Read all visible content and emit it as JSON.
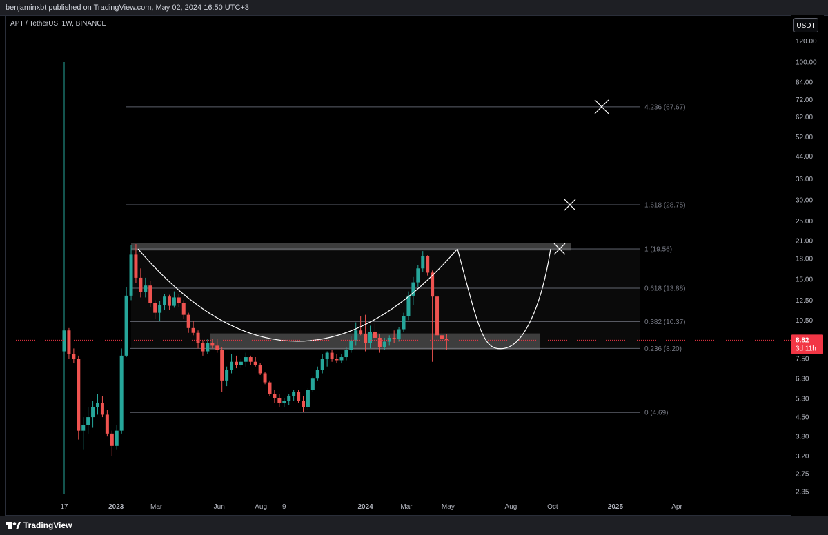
{
  "header": {
    "publish_info": "benjaminxbt published on TradingView.com, May 02, 2024 16:50 UTC+3"
  },
  "legend": {
    "symbol_info": "APT / TetherUS, 1W, BINANCE"
  },
  "price_axis": {
    "currency_button": "USDT"
  },
  "footer": {
    "brand": "TradingView"
  },
  "colors": {
    "up": "#26a69a",
    "down": "#ef5350",
    "current_price": "#f23645"
  },
  "chart_data": {
    "type": "candlestick",
    "symbol": "APT / TetherUS",
    "interval": "1W",
    "exchange": "BINANCE",
    "scale": "log",
    "y_ticks": [
      120,
      100,
      84,
      72,
      62,
      52,
      44,
      36,
      30,
      25,
      21,
      18,
      15,
      12.5,
      10.5,
      7.5,
      6.3,
      5.3,
      4.5,
      3.8,
      3.2,
      2.75,
      2.35
    ],
    "x_ticks": [
      "17",
      "2023",
      "Mar",
      "Jun",
      "Aug",
      "9",
      "2024",
      "Mar",
      "May",
      "Aug",
      "Oct",
      "2025",
      "Apr"
    ],
    "current_price": {
      "value": "8.82",
      "countdown": "3d 11h"
    },
    "fib_levels": [
      {
        "label": "4.236 (67.67)",
        "price": 67.67
      },
      {
        "label": "1.618 (28.75)",
        "price": 28.75
      },
      {
        "label": "1 (19.56)",
        "price": 19.56
      },
      {
        "label": "0.618 (13.88)",
        "price": 13.88
      },
      {
        "label": "0.382 (10.37)",
        "price": 10.37
      },
      {
        "label": "0.236 (8.20)",
        "price": 8.2
      },
      {
        "label": "0 (4.69)",
        "price": 4.69
      }
    ],
    "candles": [
      {
        "t": "2022-10-17",
        "o": 8.0,
        "h": 100.0,
        "l": 2.3,
        "c": 9.6
      },
      {
        "t": "2022-10-24",
        "o": 9.6,
        "h": 9.8,
        "l": 7.5,
        "c": 7.8
      },
      {
        "t": "2022-10-31",
        "o": 7.8,
        "h": 8.2,
        "l": 7.2,
        "c": 7.5
      },
      {
        "t": "2022-11-07",
        "o": 7.5,
        "h": 7.7,
        "l": 3.7,
        "c": 4.0
      },
      {
        "t": "2022-11-14",
        "o": 4.0,
        "h": 4.5,
        "l": 3.4,
        "c": 4.2
      },
      {
        "t": "2022-11-21",
        "o": 4.2,
        "h": 4.9,
        "l": 3.9,
        "c": 4.5
      },
      {
        "t": "2022-11-28",
        "o": 4.5,
        "h": 5.2,
        "l": 4.1,
        "c": 4.9
      },
      {
        "t": "2022-12-05",
        "o": 4.9,
        "h": 5.5,
        "l": 4.6,
        "c": 5.1
      },
      {
        "t": "2022-12-12",
        "o": 5.1,
        "h": 5.4,
        "l": 4.5,
        "c": 4.6
      },
      {
        "t": "2022-12-19",
        "o": 4.6,
        "h": 4.8,
        "l": 3.8,
        "c": 3.9
      },
      {
        "t": "2022-12-26",
        "o": 3.9,
        "h": 4.0,
        "l": 3.2,
        "c": 3.5
      },
      {
        "t": "2023-01-02",
        "o": 3.5,
        "h": 4.2,
        "l": 3.4,
        "c": 4.0
      },
      {
        "t": "2023-01-09",
        "o": 4.0,
        "h": 8.2,
        "l": 3.9,
        "c": 7.7
      },
      {
        "t": "2023-01-16",
        "o": 7.7,
        "h": 14.0,
        "l": 7.6,
        "c": 13.0
      },
      {
        "t": "2023-01-23",
        "o": 13.0,
        "h": 20.2,
        "l": 12.5,
        "c": 18.6
      },
      {
        "t": "2023-01-30",
        "o": 18.6,
        "h": 20.4,
        "l": 14.5,
        "c": 15.2
      },
      {
        "t": "2023-02-06",
        "o": 15.2,
        "h": 16.5,
        "l": 12.8,
        "c": 13.4
      },
      {
        "t": "2023-02-13",
        "o": 13.4,
        "h": 15.2,
        "l": 12.8,
        "c": 14.2
      },
      {
        "t": "2023-02-20",
        "o": 14.2,
        "h": 14.8,
        "l": 11.8,
        "c": 12.2
      },
      {
        "t": "2023-02-27",
        "o": 12.2,
        "h": 12.5,
        "l": 10.6,
        "c": 11.2
      },
      {
        "t": "2023-03-06",
        "o": 11.2,
        "h": 12.4,
        "l": 10.4,
        "c": 12.0
      },
      {
        "t": "2023-03-13",
        "o": 12.0,
        "h": 13.2,
        "l": 11.5,
        "c": 12.9
      },
      {
        "t": "2023-03-20",
        "o": 12.9,
        "h": 13.1,
        "l": 11.5,
        "c": 11.9
      },
      {
        "t": "2023-03-27",
        "o": 11.9,
        "h": 13.5,
        "l": 11.7,
        "c": 12.8
      },
      {
        "t": "2023-04-03",
        "o": 12.8,
        "h": 13.2,
        "l": 11.8,
        "c": 12.2
      },
      {
        "t": "2023-04-10",
        "o": 12.2,
        "h": 12.5,
        "l": 10.6,
        "c": 11.0
      },
      {
        "t": "2023-04-17",
        "o": 11.0,
        "h": 11.2,
        "l": 9.4,
        "c": 9.8
      },
      {
        "t": "2023-04-24",
        "o": 9.8,
        "h": 10.4,
        "l": 9.2,
        "c": 9.4
      },
      {
        "t": "2023-05-01",
        "o": 9.4,
        "h": 9.6,
        "l": 8.2,
        "c": 8.6
      },
      {
        "t": "2023-05-08",
        "o": 8.6,
        "h": 8.8,
        "l": 7.7,
        "c": 8.0
      },
      {
        "t": "2023-05-15",
        "o": 8.0,
        "h": 8.9,
        "l": 7.8,
        "c": 8.6
      },
      {
        "t": "2023-05-22",
        "o": 8.6,
        "h": 8.9,
        "l": 8.2,
        "c": 8.4
      },
      {
        "t": "2023-05-29",
        "o": 8.4,
        "h": 8.9,
        "l": 7.9,
        "c": 8.1
      },
      {
        "t": "2023-06-05",
        "o": 8.1,
        "h": 8.3,
        "l": 5.6,
        "c": 6.2
      },
      {
        "t": "2023-06-12",
        "o": 6.2,
        "h": 7.0,
        "l": 5.9,
        "c": 6.8
      },
      {
        "t": "2023-06-19",
        "o": 6.8,
        "h": 7.8,
        "l": 6.6,
        "c": 7.3
      },
      {
        "t": "2023-06-26",
        "o": 7.3,
        "h": 7.7,
        "l": 6.9,
        "c": 7.1
      },
      {
        "t": "2023-07-03",
        "o": 7.1,
        "h": 7.5,
        "l": 6.9,
        "c": 7.3
      },
      {
        "t": "2023-07-10",
        "o": 7.3,
        "h": 7.9,
        "l": 7.0,
        "c": 7.6
      },
      {
        "t": "2023-07-17",
        "o": 7.6,
        "h": 7.7,
        "l": 7.1,
        "c": 7.3
      },
      {
        "t": "2023-07-24",
        "o": 7.3,
        "h": 7.6,
        "l": 7.0,
        "c": 7.1
      },
      {
        "t": "2023-07-31",
        "o": 7.1,
        "h": 7.2,
        "l": 6.5,
        "c": 6.6
      },
      {
        "t": "2023-08-07",
        "o": 6.6,
        "h": 6.7,
        "l": 6.0,
        "c": 6.1
      },
      {
        "t": "2023-08-14",
        "o": 6.1,
        "h": 6.2,
        "l": 5.4,
        "c": 5.5
      },
      {
        "t": "2023-08-21",
        "o": 5.5,
        "h": 5.7,
        "l": 5.1,
        "c": 5.3
      },
      {
        "t": "2023-08-28",
        "o": 5.3,
        "h": 5.5,
        "l": 4.9,
        "c": 5.1
      },
      {
        "t": "2023-09-04",
        "o": 5.1,
        "h": 5.3,
        "l": 4.9,
        "c": 5.2
      },
      {
        "t": "2023-09-11",
        "o": 5.2,
        "h": 5.5,
        "l": 5.0,
        "c": 5.4
      },
      {
        "t": "2023-09-18",
        "o": 5.4,
        "h": 5.7,
        "l": 5.2,
        "c": 5.6
      },
      {
        "t": "2023-09-25",
        "o": 5.6,
        "h": 5.7,
        "l": 5.1,
        "c": 5.2
      },
      {
        "t": "2023-10-02",
        "o": 5.2,
        "h": 5.4,
        "l": 4.7,
        "c": 4.9
      },
      {
        "t": "2023-10-09",
        "o": 4.9,
        "h": 5.8,
        "l": 4.8,
        "c": 5.7
      },
      {
        "t": "2023-10-16",
        "o": 5.7,
        "h": 6.4,
        "l": 5.6,
        "c": 6.3
      },
      {
        "t": "2023-10-23",
        "o": 6.3,
        "h": 7.0,
        "l": 6.2,
        "c": 6.8
      },
      {
        "t": "2023-10-30",
        "o": 6.8,
        "h": 7.8,
        "l": 6.6,
        "c": 7.5
      },
      {
        "t": "2023-11-06",
        "o": 7.5,
        "h": 8.0,
        "l": 7.0,
        "c": 7.9
      },
      {
        "t": "2023-11-13",
        "o": 7.9,
        "h": 8.1,
        "l": 7.3,
        "c": 7.5
      },
      {
        "t": "2023-11-20",
        "o": 7.5,
        "h": 7.8,
        "l": 7.2,
        "c": 7.4
      },
      {
        "t": "2023-11-27",
        "o": 7.4,
        "h": 7.8,
        "l": 7.2,
        "c": 7.6
      },
      {
        "t": "2023-12-04",
        "o": 7.6,
        "h": 8.3,
        "l": 7.4,
        "c": 8.1
      },
      {
        "t": "2023-12-11",
        "o": 8.1,
        "h": 9.1,
        "l": 7.9,
        "c": 8.8
      },
      {
        "t": "2023-12-18",
        "o": 8.8,
        "h": 10.3,
        "l": 8.4,
        "c": 9.6
      },
      {
        "t": "2023-12-25",
        "o": 9.6,
        "h": 10.9,
        "l": 9.2,
        "c": 9.3
      },
      {
        "t": "2024-01-01",
        "o": 9.3,
        "h": 11.0,
        "l": 8.0,
        "c": 8.6
      },
      {
        "t": "2024-01-08",
        "o": 8.6,
        "h": 10.0,
        "l": 8.2,
        "c": 9.5
      },
      {
        "t": "2024-01-15",
        "o": 9.5,
        "h": 10.3,
        "l": 8.8,
        "c": 9.0
      },
      {
        "t": "2024-01-22",
        "o": 9.0,
        "h": 9.3,
        "l": 7.9,
        "c": 8.3
      },
      {
        "t": "2024-01-29",
        "o": 8.3,
        "h": 9.0,
        "l": 8.1,
        "c": 8.7
      },
      {
        "t": "2024-02-05",
        "o": 8.7,
        "h": 9.2,
        "l": 8.4,
        "c": 9.0
      },
      {
        "t": "2024-02-12",
        "o": 9.0,
        "h": 9.6,
        "l": 8.6,
        "c": 8.9
      },
      {
        "t": "2024-02-19",
        "o": 8.9,
        "h": 9.9,
        "l": 8.7,
        "c": 9.7
      },
      {
        "t": "2024-02-26",
        "o": 9.7,
        "h": 11.2,
        "l": 9.5,
        "c": 10.9
      },
      {
        "t": "2024-03-04",
        "o": 10.9,
        "h": 13.5,
        "l": 10.5,
        "c": 13.0
      },
      {
        "t": "2024-03-11",
        "o": 13.0,
        "h": 15.3,
        "l": 12.0,
        "c": 14.6
      },
      {
        "t": "2024-03-18",
        "o": 14.6,
        "h": 17.0,
        "l": 14.0,
        "c": 16.5
      },
      {
        "t": "2024-03-25",
        "o": 16.5,
        "h": 19.2,
        "l": 16.0,
        "c": 18.4
      },
      {
        "t": "2024-04-01",
        "o": 18.4,
        "h": 18.5,
        "l": 15.5,
        "c": 15.9
      },
      {
        "t": "2024-04-08",
        "o": 15.9,
        "h": 16.2,
        "l": 7.3,
        "c": 12.9
      },
      {
        "t": "2024-04-15",
        "o": 12.9,
        "h": 13.1,
        "l": 8.5,
        "c": 9.2
      },
      {
        "t": "2024-04-22",
        "o": 9.2,
        "h": 9.6,
        "l": 8.5,
        "c": 8.9
      },
      {
        "t": "2024-04-29",
        "o": 8.9,
        "h": 9.3,
        "l": 8.1,
        "c": 8.82
      }
    ]
  }
}
